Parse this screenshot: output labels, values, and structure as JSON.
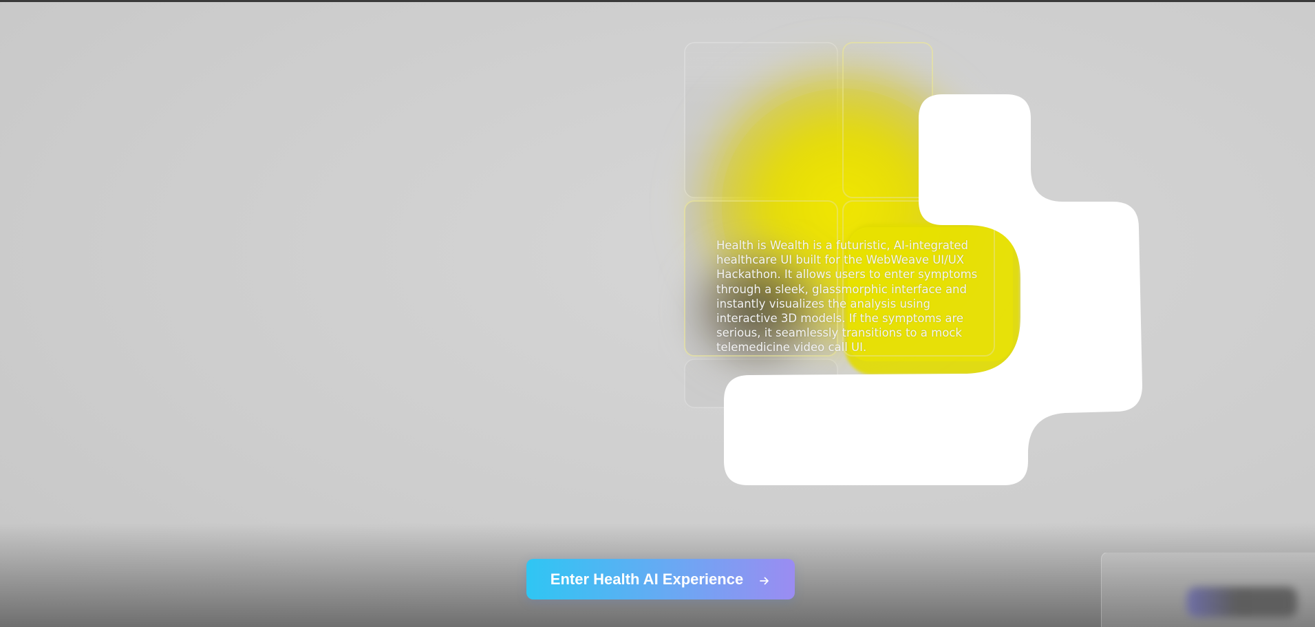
{
  "hero": {
    "description": "Health is Wealth is a futuristic, AI-integrated healthcare UI built for the WebWeave UI/UX Hackathon. It allows users to enter symptoms through a sleek, glassmorphic interface and instantly visualizes the analysis using interactive 3D models. If the symptoms are serious, it seamlessly transitions to a mock telemedicine video call UI."
  },
  "cta": {
    "label": "Enter Health AI Experience",
    "icon": "arrow-right-icon"
  },
  "colors": {
    "background": "#cfcfcf",
    "accent_yellow": "#e6dc00",
    "cta_gradient_start": "#2fc6f3",
    "cta_gradient_end": "#9b8cf2"
  }
}
